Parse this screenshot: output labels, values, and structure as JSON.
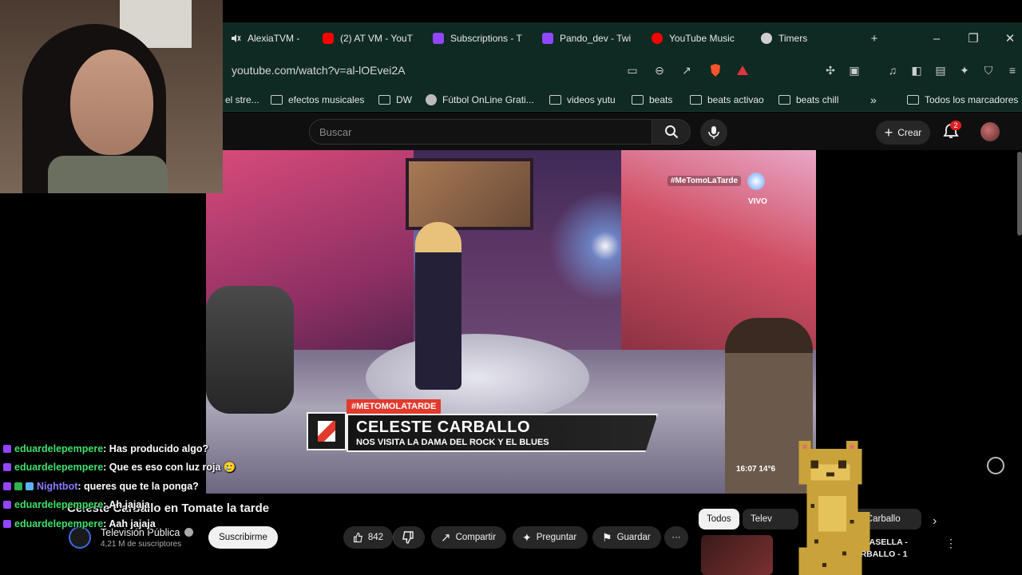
{
  "browser": {
    "tabs": [
      {
        "label": "AlexiaTVM -",
        "icon": "muted-speaker-icon"
      },
      {
        "label": "(2) AT VM - YouT",
        "icon": "youtube-icon"
      },
      {
        "label": "Subscriptions - T",
        "icon": "twitch-icon"
      },
      {
        "label": "Pando_dev - Twi",
        "icon": "twitch-icon"
      },
      {
        "label": "YouTube Music",
        "icon": "youtube-music-icon"
      },
      {
        "label": "Timers",
        "icon": "timer-bot-icon"
      }
    ],
    "new_tab": "+",
    "window_controls": {
      "minimize": "–",
      "restore": "❐",
      "close": "✕"
    },
    "url": "youtube.com/watch?v=al-lOEvei2A",
    "bookmarks": [
      {
        "label": "el stre...",
        "icon": "folder-icon"
      },
      {
        "label": "efectos musicales",
        "icon": "folder-icon"
      },
      {
        "label": "DW",
        "icon": "folder-icon"
      },
      {
        "label": "Fútbol OnLine Grati...",
        "icon": "globe-icon"
      },
      {
        "label": "videos yutu",
        "icon": "folder-icon"
      },
      {
        "label": "beats",
        "icon": "folder-icon"
      },
      {
        "label": "beats activao",
        "icon": "folder-icon"
      },
      {
        "label": "beats chill",
        "icon": "folder-icon"
      }
    ],
    "bookmarks_overflow": "»",
    "all_bookmarks": "Todos los marcadores"
  },
  "youtube": {
    "search_placeholder": "Buscar",
    "create_label": "Crear",
    "notifications_count": "2"
  },
  "video": {
    "hashtag": "#MeTomoLaTarde",
    "live_label": "VIVO",
    "lower_third_tag": "#METOMOLATARDE",
    "lower_third_title": "CELESTE CARBALLO",
    "lower_third_subtitle": "NOS VISITA LA DAMA DEL ROCK Y EL BLUES",
    "timecode": "16:07  14°6",
    "title": "Celeste Carballo en Tomate la tarde"
  },
  "channel": {
    "name": "Televisión Pública",
    "subscribers": "4,21 M de suscriptores",
    "subscribe_label": "Suscribirme"
  },
  "actions": {
    "likes": "842",
    "share": "Compartir",
    "ask": "Preguntar",
    "save": "Guardar",
    "more": "···"
  },
  "chips": [
    {
      "label": "Todos"
    },
    {
      "label": "Telev"
    },
    {
      "label": "te Carballo"
    }
  ],
  "recommended": {
    "title_line1": "O CASELLA -",
    "title_line2": "ARBALLO - 1"
  },
  "chat": [
    {
      "user": "eduardelepempere",
      "message": ": Has producido algo?",
      "user_color": "#3fe06b",
      "badges": [
        "sub"
      ]
    },
    {
      "user": "eduardelepempere",
      "message": ": Que es eso con luz roja 🥲",
      "user_color": "#3fe06b",
      "badges": [
        "sub"
      ]
    },
    {
      "user": "Nightbot",
      "message": ": queres que te la ponga?",
      "user_color": "#8a7dff",
      "badges": [
        "sub",
        "mod",
        "bot"
      ]
    },
    {
      "user": "eduardelepempere",
      "message": ": Ah jajaja",
      "user_color": "#3fe06b",
      "badges": [
        "sub"
      ]
    },
    {
      "user": "eduardelepempere",
      "message": ": Aah jajaja",
      "user_color": "#3fe06b",
      "badges": [
        "sub"
      ]
    }
  ],
  "colors": {
    "chrome_bg": "#0f2a22",
    "youtube_bg": "#0f0f0f",
    "accent_red": "#e23a2d",
    "chat_user_green": "#3fe06b",
    "bot_purple": "#8a7dff"
  }
}
